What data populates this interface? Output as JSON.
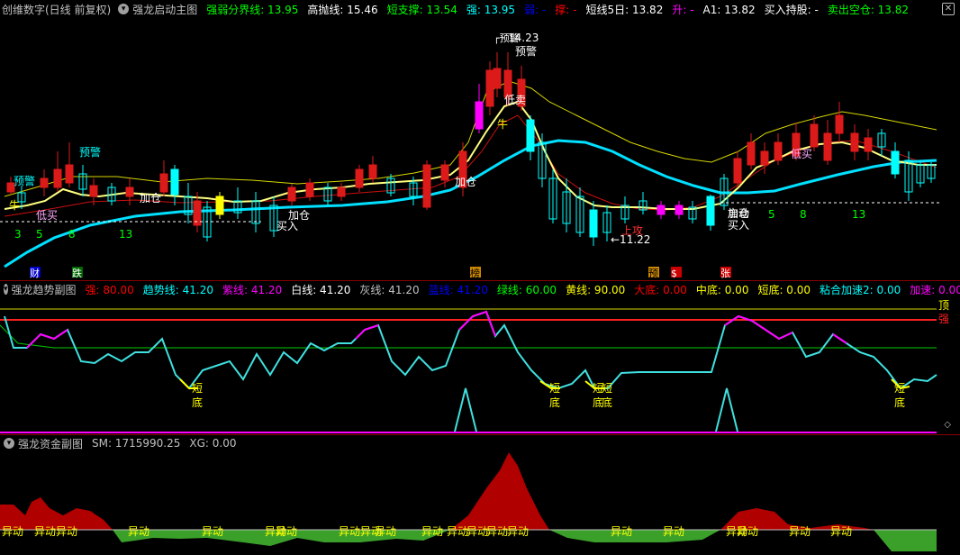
{
  "header_main": {
    "app": "创维数字(日线 前复权)",
    "indicator": "强龙启动主图",
    "items": [
      {
        "label": "强弱分界线:",
        "value": "13.95",
        "color": "#00ff00"
      },
      {
        "label": "高抛线:",
        "value": "15.46",
        "color": "#ffffff"
      },
      {
        "label": "短支撑:",
        "value": "13.54",
        "color": "#00ff00"
      },
      {
        "label": "强:",
        "value": "13.95",
        "color": "#00ffff"
      },
      {
        "label": "弱:",
        "value": "-",
        "color": "#0000ff"
      },
      {
        "label": "撑:",
        "value": "-",
        "color": "#ff0000"
      },
      {
        "label": "短线5日:",
        "value": "13.82",
        "color": "#ffffff"
      },
      {
        "label": "升:",
        "value": "-",
        "color": "#ff00ff"
      },
      {
        "label": "A1:",
        "value": "13.82",
        "color": "#ffffff"
      },
      {
        "label": "买入持股:",
        "value": "-",
        "color": "#ffffff"
      },
      {
        "label": "卖出空仓:",
        "value": "13.82",
        "color": "#00ff00"
      }
    ]
  },
  "header_trend": {
    "indicator": "强龙趋势副图",
    "items": [
      {
        "label": "强:",
        "value": "80.00",
        "color": "#ff0000"
      },
      {
        "label": "趋势线:",
        "value": "41.20",
        "color": "#00ffff"
      },
      {
        "label": "紫线:",
        "value": "41.20",
        "color": "#ff00ff"
      },
      {
        "label": "白线:",
        "value": "41.20",
        "color": "#ffffff"
      },
      {
        "label": "灰线:",
        "value": "41.20",
        "color": "#c0c0c0"
      },
      {
        "label": "蓝线:",
        "value": "41.20",
        "color": "#0000ff"
      },
      {
        "label": "绿线:",
        "value": "60.00",
        "color": "#00ff00"
      },
      {
        "label": "黄线:",
        "value": "90.00",
        "color": "#ffff00"
      },
      {
        "label": "大底:",
        "value": "0.00",
        "color": "#ff0000"
      },
      {
        "label": "中底:",
        "value": "0.00",
        "color": "#ffff00"
      },
      {
        "label": "短底:",
        "value": "0.00",
        "color": "#ffff00"
      },
      {
        "label": "粘合加速2:",
        "value": "0.00",
        "color": "#00ffff"
      },
      {
        "label": "加速:",
        "value": "0.00",
        "color": "#ff00ff"
      }
    ]
  },
  "header_fund": {
    "indicator": "强龙资金副图",
    "items": [
      {
        "label": "SM:",
        "value": "1715990.25",
        "color": "#c0c0c0"
      },
      {
        "label": "XG:",
        "value": "0.00",
        "color": "#c0c0c0"
      }
    ]
  },
  "labels_main": {
    "yujing": "预警",
    "dimai": "低买",
    "jiacang": "加仓",
    "mairu": "买入",
    "niu": "牛",
    "dimai2": "低卖",
    "qidong": "启动",
    "shanggong": "上攻",
    "low_price": "11.22",
    "num3": "3",
    "num5": "5",
    "num8": "8",
    "num13": "13",
    "high_label": "14.23"
  },
  "labels_trend": {
    "ding": "顶",
    "qiang": "强",
    "duan": "短",
    "di": "底"
  },
  "labels_fund": {
    "yidong": "异动"
  },
  "event_tags": {
    "cai": "财",
    "die": "跌",
    "bang": "榜",
    "yu": "预",
    "ping": "$",
    "zhang": "张"
  }
}
